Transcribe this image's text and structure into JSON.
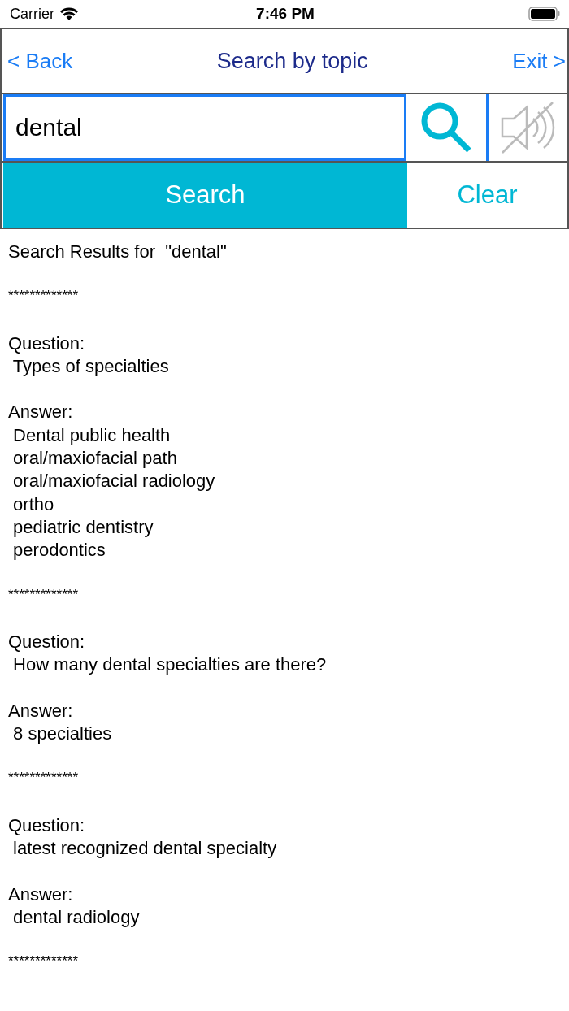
{
  "status_bar": {
    "carrier": "Carrier",
    "time": "7:46 PM"
  },
  "nav": {
    "back": "< Back",
    "title": "Search by topic",
    "exit": "Exit >"
  },
  "search": {
    "value": "dental",
    "sound_muted": true
  },
  "buttons": {
    "search": "Search",
    "clear": "Clear"
  },
  "results": {
    "heading": "Search Results for  \"dental\"",
    "entries": [
      {
        "separator": "*************",
        "question_label": "Question:",
        "question": " Types of specialties",
        "answer_label": "Answer:",
        "answers": [
          " Dental public health",
          " oral/maxiofacial path",
          " oral/maxiofacial radiology",
          " ortho",
          " pediatric dentistry",
          " perodontics"
        ]
      },
      {
        "separator": "*************",
        "question_label": "Question:",
        "question": " How many dental specialties are there?",
        "answer_label": "Answer:",
        "answers": [
          " 8 specialties"
        ]
      },
      {
        "separator": "*************",
        "question_label": "Question:",
        "question": " latest recognized dental specialty",
        "answer_label": "Answer:",
        "answers": [
          " dental radiology"
        ]
      }
    ],
    "final_separator": "*************"
  }
}
